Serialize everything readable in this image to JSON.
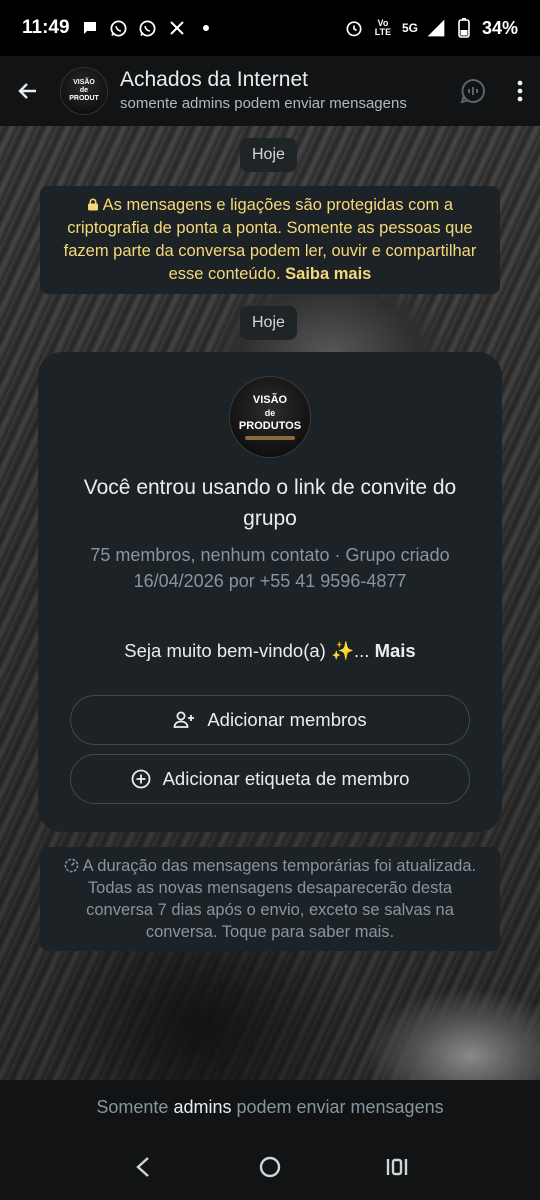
{
  "status_bar": {
    "time": "11:49",
    "network": "5G",
    "battery": "34%",
    "lte_label": "LTE"
  },
  "header": {
    "title": "Achados da Internet",
    "subtitle": "somente admins podem enviar mensagens",
    "avatar_lines": [
      "VISÃO",
      "de",
      "PRODUT"
    ]
  },
  "chat": {
    "date_chip_1": "Hoje",
    "date_chip_2": "Hoje",
    "encryption_notice": "As mensagens e ligações são protegidas com a criptografia de ponta a ponta. Somente as pessoas que fazem parte da conversa podem ler, ouvir e compartilhar esse conteúdo.",
    "encryption_link": "Saiba mais",
    "group_card": {
      "avatar_lines": [
        "VISÃO",
        "de",
        "PRODUTOS"
      ],
      "title": "Você entrou usando o link de convite do grupo",
      "meta": "75 membros, nenhum contato · Grupo criado 16/04/2026 por +55 41 9596-4877",
      "description": "Seja muito bem-vindo(a) ✨...",
      "more_label": "Mais",
      "add_members_label": "Adicionar membros",
      "add_tag_label": "Adicionar etiqueta de membro"
    },
    "temp_notice": "A duração das mensagens temporárias foi atualizada. Todas as novas mensagens desaparecerão desta conversa 7 dias após o envio, exceto se salvas na conversa. Toque para saber mais."
  },
  "footer": {
    "prefix": "Somente",
    "highlight": "admins",
    "suffix": "podem enviar mensagens"
  },
  "colors": {
    "header_bg": "#111314",
    "bubble_bg": "#1c2225",
    "card_bg": "#1d2226",
    "notice_text": "#f5d87a",
    "muted_text": "#8696a0"
  }
}
